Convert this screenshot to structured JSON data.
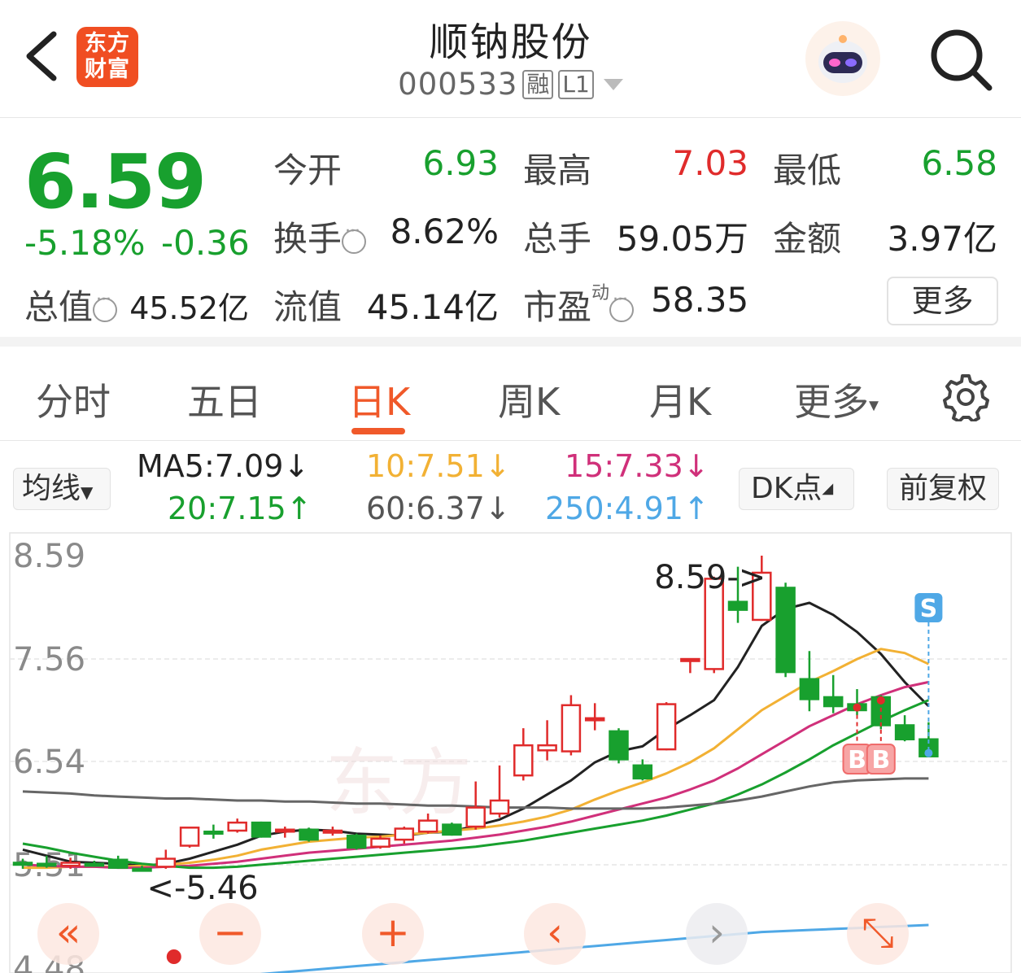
{
  "header": {
    "logo_line1": "东方",
    "logo_line2": "财富",
    "stock_name": "顺钠股份",
    "stock_code": "000533",
    "tag_margin": "融",
    "tag_level": "L1"
  },
  "quote": {
    "price": "6.59",
    "change_pct": "-5.18%",
    "change_amt": "-0.36",
    "open_label": "今开",
    "open_value": "6.93",
    "high_label": "最高",
    "high_value": "7.03",
    "low_label": "最低",
    "low_value": "6.58",
    "turnover_label": "换手",
    "turnover_value": "8.62%",
    "volume_label": "总手",
    "volume_value": "59.05万",
    "amount_label": "金额",
    "amount_value": "3.97亿",
    "mktcap_label": "总值",
    "mktcap_value": "45.52亿",
    "float_label": "流值",
    "float_value": "45.14亿",
    "pe_label": "市盈",
    "pe_sup": "动",
    "pe_value": "58.35",
    "more_label": "更多"
  },
  "tabs": {
    "items": [
      "分时",
      "五日",
      "日K",
      "周K",
      "月K",
      "更多"
    ],
    "active": "日K"
  },
  "ma": {
    "button": "均线",
    "ma5": "MA5:7.09↓",
    "ma10": "10:7.51↓",
    "ma15": "15:7.33↓",
    "ma20": "20:7.15↑",
    "ma60": "60:6.37↓",
    "ma250": "250:4.91↑",
    "dk_button": "DK点",
    "fq_button": "前复权"
  },
  "colors": {
    "up": "#e02b2b",
    "down": "#18a02e",
    "accent": "#f0592a",
    "ma5": "#222222",
    "ma10": "#f2b134",
    "ma15": "#d0307a",
    "ma20": "#18a02e",
    "ma60": "#666666",
    "ma250": "#4fa8e6"
  },
  "chart_data": {
    "type": "candlestick",
    "y_ticks": [
      "8.59",
      "7.56",
      "6.54",
      "5.51",
      "4.48"
    ],
    "ylim": [
      4.48,
      8.59
    ],
    "max_label": "8.59->",
    "min_label": "<-5.46",
    "signal_s": "S",
    "signal_b": "B",
    "candles": [
      {
        "o": 5.53,
        "c": 5.51,
        "h": 5.57,
        "l": 5.47
      },
      {
        "o": 5.52,
        "c": 5.51,
        "h": 5.6,
        "l": 5.48
      },
      {
        "o": 5.5,
        "c": 5.53,
        "h": 5.58,
        "l": 5.47
      },
      {
        "o": 5.52,
        "c": 5.51,
        "h": 5.55,
        "l": 5.49
      },
      {
        "o": 5.56,
        "c": 5.48,
        "h": 5.6,
        "l": 5.47
      },
      {
        "o": 5.47,
        "c": 5.46,
        "h": 5.5,
        "l": 5.46
      },
      {
        "o": 5.49,
        "c": 5.57,
        "h": 5.66,
        "l": 5.47
      },
      {
        "o": 5.7,
        "c": 5.88,
        "h": 5.88,
        "l": 5.68
      },
      {
        "o": 5.84,
        "c": 5.82,
        "h": 5.91,
        "l": 5.77
      },
      {
        "o": 5.85,
        "c": 5.93,
        "h": 5.97,
        "l": 5.83
      },
      {
        "o": 5.93,
        "c": 5.79,
        "h": 5.94,
        "l": 5.78
      },
      {
        "o": 5.85,
        "c": 5.86,
        "h": 5.89,
        "l": 5.78
      },
      {
        "o": 5.86,
        "c": 5.76,
        "h": 5.88,
        "l": 5.74
      },
      {
        "o": 5.84,
        "c": 5.85,
        "h": 5.89,
        "l": 5.8
      },
      {
        "o": 5.8,
        "c": 5.68,
        "h": 5.82,
        "l": 5.66
      },
      {
        "o": 5.69,
        "c": 5.77,
        "h": 5.8,
        "l": 5.67
      },
      {
        "o": 5.76,
        "c": 5.87,
        "h": 5.89,
        "l": 5.72
      },
      {
        "o": 5.84,
        "c": 5.95,
        "h": 6.02,
        "l": 5.82
      },
      {
        "o": 5.91,
        "c": 5.81,
        "h": 5.93,
        "l": 5.8
      },
      {
        "o": 5.89,
        "c": 6.08,
        "h": 6.34,
        "l": 5.86
      },
      {
        "o": 6.02,
        "c": 6.15,
        "h": 6.5,
        "l": 5.98
      },
      {
        "o": 6.4,
        "c": 6.7,
        "h": 6.87,
        "l": 6.35
      },
      {
        "o": 6.65,
        "c": 6.7,
        "h": 6.95,
        "l": 6.55
      },
      {
        "o": 6.64,
        "c": 7.1,
        "h": 7.2,
        "l": 6.6
      },
      {
        "o": 6.96,
        "c": 6.97,
        "h": 7.12,
        "l": 6.85
      },
      {
        "o": 6.84,
        "c": 6.56,
        "h": 6.87,
        "l": 6.52
      },
      {
        "o": 6.5,
        "c": 6.37,
        "h": 6.56,
        "l": 6.35
      },
      {
        "o": 6.66,
        "c": 7.11,
        "h": 7.13,
        "l": 6.65
      },
      {
        "o": 7.56,
        "c": 7.56,
        "h": 7.56,
        "l": 7.42
      },
      {
        "o": 7.46,
        "c": 8.36,
        "h": 8.38,
        "l": 7.42
      },
      {
        "o": 8.13,
        "c": 8.05,
        "h": 8.48,
        "l": 7.92
      },
      {
        "o": 7.95,
        "c": 8.42,
        "h": 8.59,
        "l": 7.94
      },
      {
        "o": 8.27,
        "c": 7.43,
        "h": 8.32,
        "l": 7.38
      },
      {
        "o": 7.36,
        "c": 7.16,
        "h": 7.64,
        "l": 7.04
      },
      {
        "o": 7.18,
        "c": 7.09,
        "h": 7.4,
        "l": 7.02
      },
      {
        "o": 7.11,
        "c": 7.05,
        "h": 7.26,
        "l": 7.0
      },
      {
        "o": 7.18,
        "c": 6.9,
        "h": 7.2,
        "l": 6.86
      },
      {
        "o": 6.9,
        "c": 6.76,
        "h": 7.0,
        "l": 6.74
      },
      {
        "o": 6.76,
        "c": 6.59,
        "h": 6.93,
        "l": 6.58
      }
    ],
    "ma_series": {
      "MA5": [
        5.66,
        5.6,
        5.54,
        5.53,
        5.52,
        5.5,
        5.52,
        5.57,
        5.64,
        5.71,
        5.8,
        5.84,
        5.86,
        5.85,
        5.82,
        5.81,
        5.8,
        5.83,
        5.84,
        5.9,
        5.96,
        6.07,
        6.21,
        6.35,
        6.53,
        6.64,
        6.69,
        6.86,
        7.0,
        7.15,
        7.48,
        7.89,
        8.06,
        8.12,
        8.0,
        7.83,
        7.61,
        7.33,
        7.09
      ],
      "MA10": [
        5.48,
        5.48,
        5.49,
        5.49,
        5.49,
        5.5,
        5.51,
        5.53,
        5.56,
        5.6,
        5.66,
        5.7,
        5.74,
        5.76,
        5.78,
        5.79,
        5.81,
        5.83,
        5.85,
        5.87,
        5.9,
        5.94,
        5.99,
        6.06,
        6.16,
        6.25,
        6.33,
        6.42,
        6.53,
        6.67,
        6.86,
        7.05,
        7.19,
        7.33,
        7.44,
        7.56,
        7.66,
        7.62,
        7.51
      ],
      "MA15": [
        5.51,
        5.5,
        5.49,
        5.49,
        5.48,
        5.48,
        5.49,
        5.5,
        5.52,
        5.54,
        5.57,
        5.6,
        5.63,
        5.65,
        5.67,
        5.69,
        5.71,
        5.73,
        5.75,
        5.78,
        5.81,
        5.85,
        5.89,
        5.94,
        6.0,
        6.06,
        6.12,
        6.18,
        6.26,
        6.35,
        6.47,
        6.61,
        6.75,
        6.89,
        7.0,
        7.11,
        7.2,
        7.28,
        7.33
      ],
      "MA20": [
        5.72,
        5.68,
        5.63,
        5.59,
        5.55,
        5.52,
        5.5,
        5.48,
        5.48,
        5.49,
        5.51,
        5.53,
        5.55,
        5.57,
        5.59,
        5.61,
        5.63,
        5.65,
        5.67,
        5.69,
        5.72,
        5.75,
        5.79,
        5.83,
        5.87,
        5.91,
        5.95,
        6.0,
        6.06,
        6.12,
        6.21,
        6.31,
        6.43,
        6.56,
        6.7,
        6.82,
        6.94,
        7.05,
        7.15
      ],
      "MA60": [
        6.24,
        6.23,
        6.22,
        6.2,
        6.19,
        6.18,
        6.17,
        6.17,
        6.16,
        6.15,
        6.15,
        6.14,
        6.14,
        6.13,
        6.12,
        6.12,
        6.11,
        6.1,
        6.1,
        6.09,
        6.08,
        6.08,
        6.08,
        6.07,
        6.07,
        6.07,
        6.07,
        6.08,
        6.1,
        6.12,
        6.15,
        6.19,
        6.24,
        6.29,
        6.33,
        6.35,
        6.36,
        6.37,
        6.37
      ],
      "MA250": [
        4.22,
        4.24,
        4.26,
        4.28,
        4.3,
        4.32,
        4.34,
        4.36,
        4.38,
        4.4,
        4.42,
        4.44,
        4.46,
        4.48,
        4.5,
        4.52,
        4.54,
        4.56,
        4.58,
        4.6,
        4.62,
        4.64,
        4.66,
        4.68,
        4.7,
        4.72,
        4.74,
        4.76,
        4.78,
        4.8,
        4.82,
        4.84,
        4.85,
        4.86,
        4.87,
        4.88,
        4.89,
        4.9,
        4.91
      ]
    }
  },
  "controls": {
    "first": "«",
    "zoom_out": "−",
    "zoom_in": "+",
    "prev": "‹",
    "next": "›",
    "expand": "⤡"
  }
}
